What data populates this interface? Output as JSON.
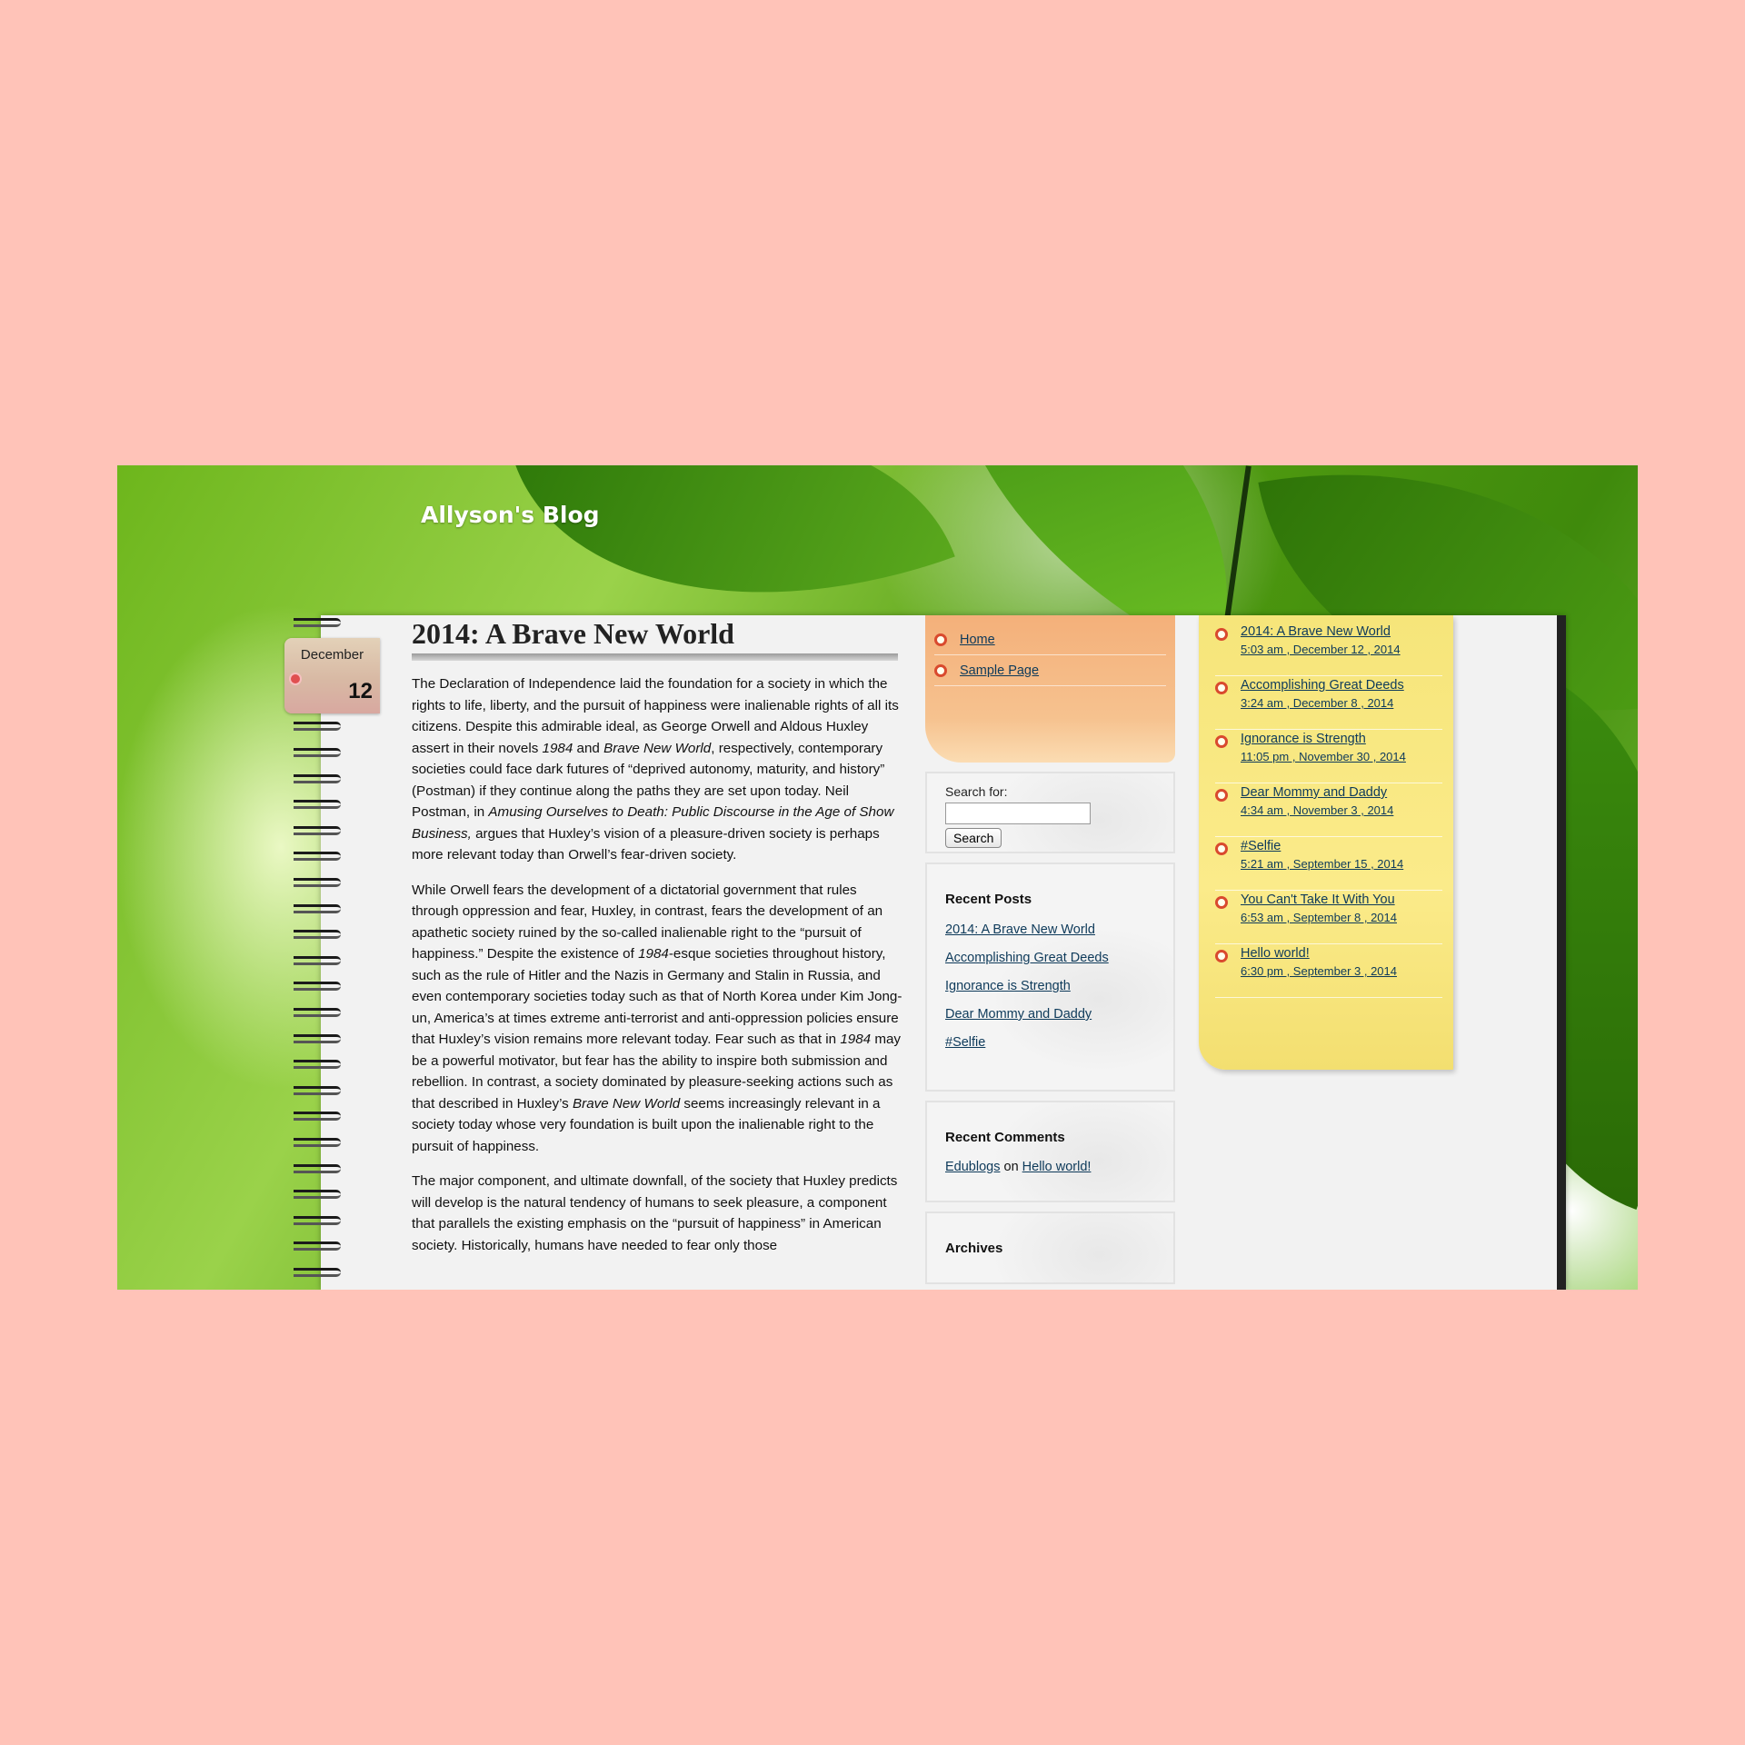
{
  "site": {
    "title": "Allyson's Blog"
  },
  "post": {
    "month": "December",
    "day": "12",
    "title": "2014: A Brave New World",
    "paragraphs": [
      [
        {
          "t": "The Declaration of Independence laid the foundation for a society in which the rights to life, liberty, and the pursuit of happiness were inalienable rights of all its citizens. Despite this admirable ideal, as George Orwell and Aldous Huxley assert in their novels "
        },
        {
          "t": "1984",
          "i": true
        },
        {
          "t": " and "
        },
        {
          "t": "Brave New World",
          "i": true
        },
        {
          "t": ", respectively, contemporary societies could face dark futures of “deprived autonomy, maturity, and history” (Postman) if they continue along the paths they are set upon today. Neil Postman, in "
        },
        {
          "t": "Amusing Ourselves to Death: Public Discourse in the Age of Show Business,",
          "i": true
        },
        {
          "t": " argues that Huxley’s vision of a pleasure-driven society is perhaps more relevant today than Orwell’s fear-driven society."
        }
      ],
      [
        {
          "t": "While Orwell fears the development of a dictatorial government that rules through oppression and fear, Huxley, in contrast, fears the development of an apathetic society ruined by the so-called inalienable right to the “pursuit of happiness.” Despite the existence of "
        },
        {
          "t": "1984",
          "i": true
        },
        {
          "t": "-esque societies throughout history, such as the rule of Hitler and the Nazis in Germany and Stalin in Russia, and even contemporary societies today such as that of North Korea under Kim Jong-un, America’s at times extreme anti-terrorist and anti-oppression policies ensure that Huxley’s vision remains more relevant today. Fear such as that in "
        },
        {
          "t": "1984",
          "i": true
        },
        {
          "t": " may be a powerful motivator, but fear has the ability to inspire both submission and rebellion. In contrast, a society dominated by pleasure-seeking actions such as that described in Huxley’s "
        },
        {
          "t": "Brave New World",
          "i": true
        },
        {
          "t": " seems increasingly relevant in a society today whose very foundation is built upon the inalienable right to the pursuit of happiness."
        }
      ],
      [
        {
          "t": "The major component, and ultimate downfall, of the society that Huxley predicts will develop is the natural tendency of humans to seek pleasure, a component that parallels the existing emphasis on the “pursuit of happiness” in American society. Historically, humans have needed to fear only those"
        }
      ]
    ]
  },
  "pages": [
    "Home",
    "Sample Page"
  ],
  "search": {
    "label": "Search for:",
    "button": "Search",
    "value": ""
  },
  "recent_posts": {
    "title": "Recent Posts",
    "items": [
      "2014: A Brave New World",
      "Accomplishing Great Deeds",
      "Ignorance is Strength",
      "Dear Mommy and Daddy",
      "#Selfie"
    ]
  },
  "recent_comments": {
    "title": "Recent Comments",
    "author": "Edublogs",
    "on": "on",
    "post": "Hello world!"
  },
  "archives": {
    "title": "Archives"
  },
  "sticky_posts": [
    {
      "title": "2014: A Brave New World",
      "date": "5:03 am , December 12 , 2014"
    },
    {
      "title": "Accomplishing Great Deeds",
      "date": "3:24 am , December 8 , 2014"
    },
    {
      "title": "Ignorance is Strength",
      "date": "11:05 pm , November 30 , 2014"
    },
    {
      "title": "Dear Mommy and Daddy",
      "date": "4:34 am , November 3 , 2014"
    },
    {
      "title": "#Selfie",
      "date": "5:21 am , September 15 , 2014"
    },
    {
      "title": "You Can't Take It With You",
      "date": "6:53 am , September 8 , 2014"
    },
    {
      "title": "Hello world!",
      "date": "6:30 pm , September 3 , 2014"
    }
  ],
  "colors": {
    "page_bg": "#ffc3b8",
    "link": "#0e3a5a",
    "bullet": "#d94a2e",
    "sticky": "#fbeb8a",
    "tab": "#f4b07a"
  }
}
